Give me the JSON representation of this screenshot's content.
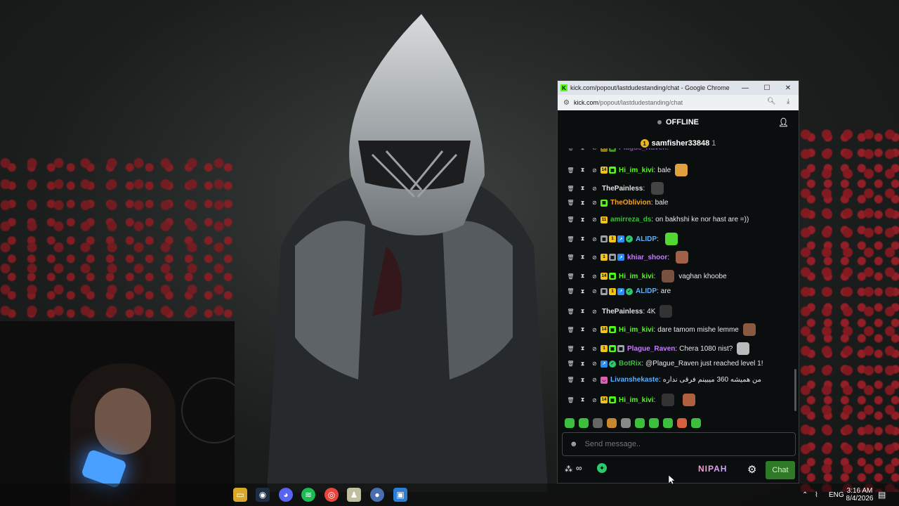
{
  "window": {
    "title": "kick.com/popout/lastdudestanding/chat - Google Chrome",
    "url_host": "kick.com",
    "url_path": "/popout/lastdudestanding/chat",
    "minimize": "—",
    "maximize": "☐",
    "close": "✕"
  },
  "chat": {
    "status": "OFFLINE",
    "pinned_user": "samfisher33848",
    "pinned_count": "1",
    "input_placeholder": "Send message..",
    "send_button": "Chat",
    "extension_label": "NIPAH",
    "infinity": "∞"
  },
  "messages": [
    {
      "badges": [
        "yel14",
        "gre"
      ],
      "user": "Plague_Raven",
      "color": "#c77dff",
      "text": "",
      "partial": true
    },
    {
      "badges": [
        "yel14",
        "gre"
      ],
      "user": "Hi_im_kivi",
      "color": "#53fc18",
      "text": "bale",
      "emote": "#e0a040"
    },
    {
      "badges": [],
      "user": "ThePainless",
      "color": "#e0e0e0",
      "text": "",
      "emote": "#444"
    },
    {
      "badges": [
        "gre"
      ],
      "user": "TheOblivion",
      "color": "#f7a21b",
      "text": "bale"
    },
    {
      "badges": [
        "yel11"
      ],
      "user": "amirreza_ds",
      "color": "#3cbf3c",
      "text": "on bakhshi ke nor hast are =))"
    },
    {
      "badges": [
        "gry",
        "yel1",
        "blu",
        "dia"
      ],
      "user": "ALIDP",
      "color": "#5ab0ff",
      "text": "",
      "emote": "#53d833"
    },
    {
      "badges": [
        "yel1",
        "gry",
        "blu"
      ],
      "user": "khiar_shoor",
      "color": "#c77dff",
      "text": "",
      "emote": "#a0604a"
    },
    {
      "badges": [
        "yel14",
        "gre"
      ],
      "user": "Hi_im_kivi",
      "color": "#53fc18",
      "text": "vaghan khoobe",
      "emote_before": "#7a5040"
    },
    {
      "badges": [
        "gry",
        "yel1",
        "blu",
        "dia"
      ],
      "user": "ALIDP",
      "color": "#5ab0ff",
      "text": "are"
    },
    {
      "badges": [],
      "user": "ThePainless",
      "color": "#e0e0e0",
      "text": "4K",
      "emote": "#333"
    },
    {
      "badges": [
        "yel14",
        "gre"
      ],
      "user": "Hi_im_kivi",
      "color": "#53fc18",
      "text": "dare tamom mishe lemme",
      "emote": "#8a5a40"
    },
    {
      "badges": [
        "yel1",
        "gre",
        "gry"
      ],
      "user": "Plague_Raven",
      "color": "#c77dff",
      "text": "Chera 1080 nist?",
      "emote": "#bbbbbb"
    },
    {
      "badges": [
        "blu",
        "dia"
      ],
      "user": "BotRix",
      "color": "#3cbf3c",
      "text": "@Plague_Raven just reached level 1!"
    },
    {
      "badges": [
        "pink"
      ],
      "user": "Livanshekaste",
      "color": "#5ab0ff",
      "text": "من همیشه 360 میبینم فرقی نداره"
    },
    {
      "badges": [
        "yel14",
        "gre"
      ],
      "user": "Hi_im_kivi",
      "color": "#53fc18",
      "text": "",
      "emote_before": "#333",
      "emote": "#b06040"
    }
  ],
  "taskbar": {
    "lang": "ENG",
    "time": "3:16 AM",
    "date": "8/4/2026"
  },
  "colors": {
    "kick_green": "#53fc18",
    "chat_bg": "#0b0e0f",
    "send_green": "#2f7a26"
  }
}
